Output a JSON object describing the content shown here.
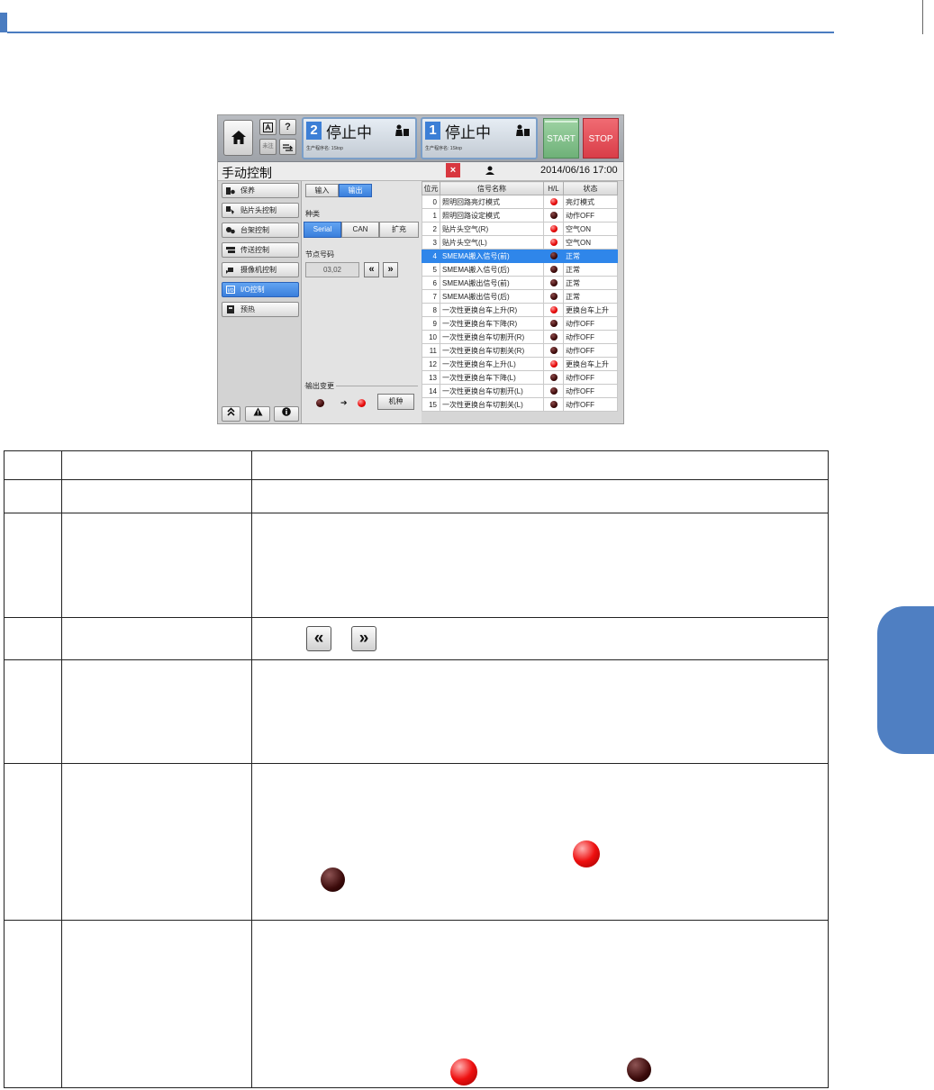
{
  "screen": {
    "lane2": {
      "number": "2",
      "state": "停止中",
      "program": "生产程序名: 1Stop"
    },
    "lane1": {
      "number": "1",
      "state": "停止中",
      "program": "生产程序名: 1Stop"
    },
    "help_label": "?",
    "dim_label": "未注",
    "start_label": "START",
    "stop_label": "STOP",
    "title": "手动控制",
    "close_label": "×",
    "datetime": "2014/06/16 17:00",
    "nav": [
      {
        "label": "保养"
      },
      {
        "label": "贴片头控制"
      },
      {
        "label": "台架控制"
      },
      {
        "label": "传送控制"
      },
      {
        "label": "摄像机控制"
      },
      {
        "label": "I/O控制",
        "active": true
      },
      {
        "label": "预热"
      }
    ],
    "io_tabs": {
      "input": "输入",
      "output": "输出",
      "active": "output"
    },
    "type_label": "种类",
    "types": {
      "serial": "Serial",
      "can": "CAN",
      "ext": "扩充",
      "active": "serial"
    },
    "node_label": "节点号码",
    "node_value": "03,02",
    "prev_label": "«",
    "next_label": "»",
    "output_change_label": "输出变更",
    "output_arrow": "➔",
    "model_button": "机种",
    "table_headers": {
      "bit": "位元",
      "name": "信号名称",
      "hl": "H/L",
      "status": "状态"
    },
    "signals": [
      {
        "bit": "0",
        "name": "照明回路亮灯模式",
        "hl": "red",
        "status": "亮灯模式"
      },
      {
        "bit": "1",
        "name": "照明回路设定模式",
        "hl": "dark",
        "status": "动作OFF"
      },
      {
        "bit": "2",
        "name": "贴片头空气(R)",
        "hl": "red",
        "status": "空气ON"
      },
      {
        "bit": "3",
        "name": "贴片头空气(L)",
        "hl": "red",
        "status": "空气ON"
      },
      {
        "bit": "4",
        "name": "SMEMA搬入信号(前)",
        "hl": "dark",
        "status": "正常",
        "selected": true
      },
      {
        "bit": "5",
        "name": "SMEMA搬入信号(后)",
        "hl": "dark",
        "status": "正常"
      },
      {
        "bit": "6",
        "name": "SMEMA搬出信号(前)",
        "hl": "dark",
        "status": "正常"
      },
      {
        "bit": "7",
        "name": "SMEMA搬出信号(后)",
        "hl": "dark",
        "status": "正常"
      },
      {
        "bit": "8",
        "name": "一次性更换台车上升(R)",
        "hl": "red",
        "status": "更换台车上升"
      },
      {
        "bit": "9",
        "name": "一次性更换台车下降(R)",
        "hl": "dark",
        "status": "动作OFF"
      },
      {
        "bit": "10",
        "name": "一次性更换台车切割开(R)",
        "hl": "dark",
        "status": "动作OFF"
      },
      {
        "bit": "11",
        "name": "一次性更换台车切割关(R)",
        "hl": "dark",
        "status": "动作OFF"
      },
      {
        "bit": "12",
        "name": "一次性更换台车上升(L)",
        "hl": "red",
        "status": "更换台车上升"
      },
      {
        "bit": "13",
        "name": "一次性更换台车下降(L)",
        "hl": "dark",
        "status": "动作OFF"
      },
      {
        "bit": "14",
        "name": "一次性更换台车切割开(L)",
        "hl": "dark",
        "status": "动作OFF"
      },
      {
        "bit": "15",
        "name": "一次性更换台车切割关(L)",
        "hl": "dark",
        "status": "动作OFF"
      }
    ]
  },
  "doc": {
    "prev_label": "«",
    "next_label": "»"
  },
  "colors": {
    "accent": "#4a7cc0",
    "selected_row": "#2f86ea",
    "start": "#7dbf86",
    "stop": "#e04a55"
  }
}
